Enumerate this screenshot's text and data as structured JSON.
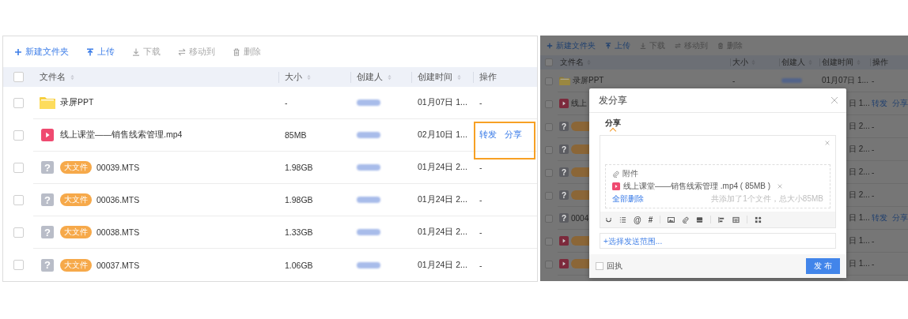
{
  "file_list": {
    "toolbar": [
      {
        "label": "新建文件夹",
        "kind": "new-folder",
        "disabled": false
      },
      {
        "label": "上传",
        "kind": "upload",
        "disabled": false
      },
      {
        "label": "下载",
        "kind": "download",
        "disabled": true
      },
      {
        "label": "移动到",
        "kind": "move",
        "disabled": true
      },
      {
        "label": "删除",
        "kind": "delete",
        "disabled": true
      }
    ],
    "select_all": {
      "checked": false
    },
    "columns": [
      {
        "label": "文件名",
        "sortable": true
      },
      {
        "label": "大小",
        "sortable": true
      },
      {
        "label": "创建人",
        "sortable": true
      },
      {
        "label": "创建时间",
        "sortable": true
      },
      {
        "label": "操作",
        "sortable": false
      }
    ],
    "rows": [
      {
        "kind": "folder",
        "name": "录屏PPT",
        "size": "-",
        "time": "01月07日 1...",
        "placeholder": "-",
        "checked": false,
        "highlighted": false
      },
      {
        "kind": "video",
        "name": "线上课堂——销售线索管理.mp4",
        "size": "85MB",
        "time": "02月10日 1...",
        "actions": [
          "转发",
          "分享"
        ],
        "checked": false,
        "highlighted": true
      },
      {
        "kind": "unknown",
        "glyph": "?",
        "tag": "大文件",
        "name": "00039.MTS",
        "size": "1.98GB",
        "time": "01月24日 2...",
        "placeholder": "-",
        "checked": false,
        "highlighted": false
      },
      {
        "kind": "unknown",
        "glyph": "?",
        "tag": "大文件",
        "name": "00036.MTS",
        "size": "1.98GB",
        "time": "01月24日 2...",
        "placeholder": "-",
        "checked": false,
        "highlighted": false
      },
      {
        "kind": "unknown",
        "glyph": "?",
        "tag": "大文件",
        "name": "00038.MTS",
        "size": "1.33GB",
        "time": "01月24日 2...",
        "placeholder": "-",
        "checked": false,
        "highlighted": false
      },
      {
        "kind": "unknown",
        "glyph": "?",
        "tag": "大文件",
        "name": "00037.MTS",
        "size": "1.06GB",
        "time": "01月24日 2...",
        "placeholder": "-",
        "checked": false,
        "highlighted": false
      }
    ]
  },
  "dimmed_view": {
    "toolbar": [
      {
        "label": "新建文件夹",
        "kind": "new-folder",
        "disabled": false
      },
      {
        "label": "上传",
        "kind": "upload",
        "disabled": false
      },
      {
        "label": "下载",
        "kind": "download",
        "disabled": true
      },
      {
        "label": "移动到",
        "kind": "move",
        "disabled": true
      },
      {
        "label": "删除",
        "kind": "delete",
        "disabled": true
      }
    ],
    "select_all": {
      "checked": false
    },
    "columns": [
      {
        "label": "文件名",
        "sortable": true
      },
      {
        "label": "大小",
        "sortable": true
      },
      {
        "label": "创建人",
        "sortable": true
      },
      {
        "label": "创建时间",
        "sortable": true
      },
      {
        "label": "操作",
        "sortable": false
      }
    ],
    "rows": [
      {
        "kind": "folder",
        "name": "录屏PPT",
        "size": "-",
        "time": "01月07日 1...",
        "placeholder": "-",
        "checked": false
      },
      {
        "kind": "video",
        "name": "线上",
        "time": "日 1...",
        "actions": [
          "转发",
          "分享"
        ],
        "checked": false
      },
      {
        "kind": "unknown",
        "glyph": "?",
        "tagged": true,
        "time": "日 2...",
        "placeholder": "-",
        "checked": false
      },
      {
        "kind": "unknown",
        "glyph": "?",
        "tagged": true,
        "time": "日 2...",
        "placeholder": "-",
        "checked": false
      },
      {
        "kind": "unknown",
        "glyph": "?",
        "tagged": true,
        "time": "日 2...",
        "placeholder": "-",
        "checked": false
      },
      {
        "kind": "unknown",
        "glyph": "?",
        "tagged": true,
        "time": "日 2...",
        "placeholder": "-",
        "checked": false
      },
      {
        "kind": "unknown",
        "glyph": "?",
        "name": "0004",
        "time": "日 1...",
        "actions": [
          "转发",
          "分享"
        ],
        "checked": false
      },
      {
        "kind": "video",
        "tagged": true,
        "time": "日 1...",
        "placeholder": "-",
        "checked": false
      },
      {
        "kind": "video",
        "tagged": true,
        "time": "日 1...",
        "placeholder": "-",
        "checked": false
      }
    ]
  },
  "share_dialog": {
    "title": "发分享",
    "tabs": [
      {
        "label": "分享",
        "selected": true
      }
    ],
    "attachment": {
      "label": "附件",
      "file": "线上课堂——销售线索管理 .mp4 ( 85MB )",
      "remove_all": "全部删除",
      "summary": "共添加了1个文件，总大小85MB"
    },
    "toolbar_glyphs": [
      "@",
      "#"
    ],
    "scope": {
      "placeholder": "+选择发送范围..."
    },
    "receipt": {
      "label": "回执",
      "checked": false
    },
    "submit": "发 布"
  }
}
